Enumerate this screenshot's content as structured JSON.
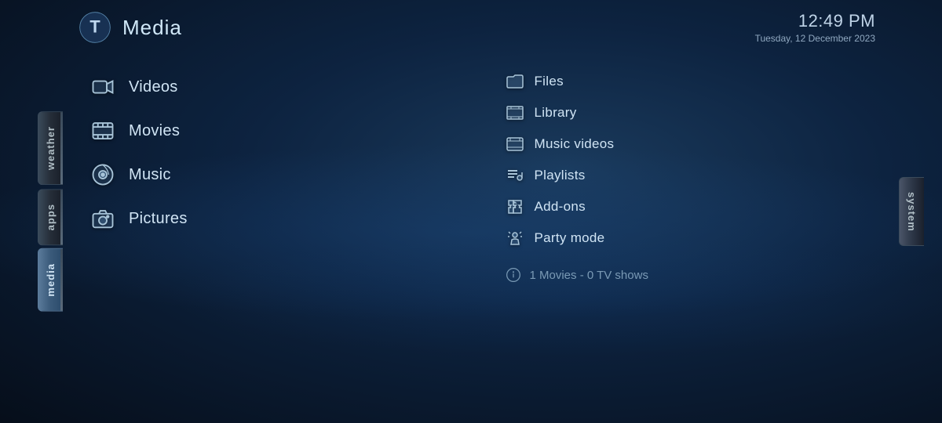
{
  "header": {
    "title": "Media",
    "time": "12:49 PM",
    "date": "Tuesday, 12 December 2023"
  },
  "sidebar": {
    "left_tabs": [
      {
        "id": "weather",
        "label": "weather"
      },
      {
        "id": "apps",
        "label": "apps"
      },
      {
        "id": "media",
        "label": "media"
      }
    ],
    "right_tab": "system"
  },
  "menu_left": {
    "items": [
      {
        "id": "videos",
        "label": "Videos",
        "icon": "video-camera"
      },
      {
        "id": "movies",
        "label": "Movies",
        "icon": "film"
      },
      {
        "id": "music",
        "label": "Music",
        "icon": "music-disc"
      },
      {
        "id": "pictures",
        "label": "Pictures",
        "icon": "camera"
      }
    ]
  },
  "menu_right": {
    "items": [
      {
        "id": "files",
        "label": "Files",
        "icon": "folder"
      },
      {
        "id": "library",
        "label": "Library",
        "icon": "film-strip"
      },
      {
        "id": "music-videos",
        "label": "Music videos",
        "icon": "film-strip-2"
      },
      {
        "id": "playlists",
        "label": "Playlists",
        "icon": "playlist"
      },
      {
        "id": "add-ons",
        "label": "Add-ons",
        "icon": "puzzle"
      },
      {
        "id": "party-mode",
        "label": "Party mode",
        "icon": "party"
      }
    ],
    "info": "1 Movies  -  0 TV shows"
  }
}
